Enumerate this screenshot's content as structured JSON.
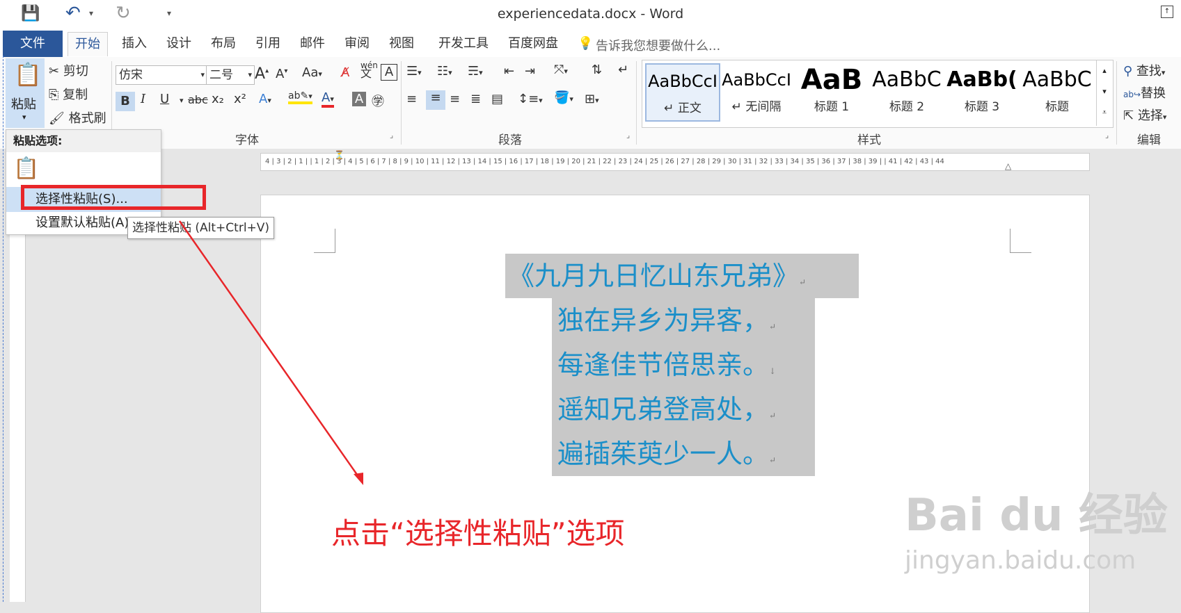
{
  "window": {
    "title": "experiencedata.docx - Word"
  },
  "tabs": [
    "文件",
    "开始",
    "插入",
    "设计",
    "布局",
    "引用",
    "邮件",
    "审阅",
    "视图",
    "开发工具",
    "百度网盘"
  ],
  "tell_me": "告诉我您想要做什么...",
  "clipboard": {
    "paste": "粘贴",
    "cut": "剪切",
    "copy": "复制",
    "format_painter": "格式刷"
  },
  "font": {
    "name": "仿宋",
    "size": "二号",
    "group_label": "字体",
    "bold": "B",
    "italic": "I",
    "underline": "U",
    "strike": "abc",
    "sub": "x₂",
    "sup": "x²",
    "case": "Aa",
    "phonetic": "wén",
    "border_char": "A"
  },
  "paragraph": {
    "group_label": "段落"
  },
  "styles": {
    "group_label": "样式",
    "items": [
      {
        "sample": "AaBbCcI",
        "name": "↵ 正文"
      },
      {
        "sample": "AaBbCcI",
        "name": "↵ 无间隔"
      },
      {
        "sample": "AaB",
        "name": "标题 1"
      },
      {
        "sample": "AaBbC",
        "name": "标题 2"
      },
      {
        "sample": "AaBb(",
        "name": "标题 3"
      },
      {
        "sample": "AaBbC",
        "name": "标题"
      }
    ]
  },
  "editing": {
    "find": "查找",
    "replace": "替换",
    "select": "选择",
    "group_label": "编辑"
  },
  "paste_menu": {
    "header": "粘贴选项:",
    "special": "选择性粘贴(S)...",
    "default": "设置默认粘贴(A)..."
  },
  "tooltip": "选择性粘贴 (Alt+Ctrl+V)",
  "ruler": "4 | 3 | 2 | 1 |   | 1 | 2 | 3 | 4 | 5 | 6 | 7 | 8 | 9 | 10 | 11 | 12 | 13 | 14 | 15 | 16 | 17 | 18 | 19 | 20 | 21 | 22 | 23 | 24 | 25 | 26 | 27 | 28 | 29 | 30 | 31 | 32 | 33 | 34 | 35 | 36 | 37 | 38 | 39 |   | 41 | 42 | 43 | 44",
  "poem": {
    "title": "《九月九日忆山东兄弟》",
    "lines": [
      "独在异乡为异客，",
      "每逢佳节倍思亲。",
      "遥知兄弟登高处，",
      "遍插茱萸少一人。"
    ]
  },
  "instruction": "点击“选择性粘贴”选项",
  "watermark": {
    "brand": "Bai du 经验",
    "url": "jingyan.baidu.com"
  },
  "colors": {
    "accent": "#2b579a",
    "poem_text": "#1b8fc9",
    "highlight": "#e8262a"
  }
}
